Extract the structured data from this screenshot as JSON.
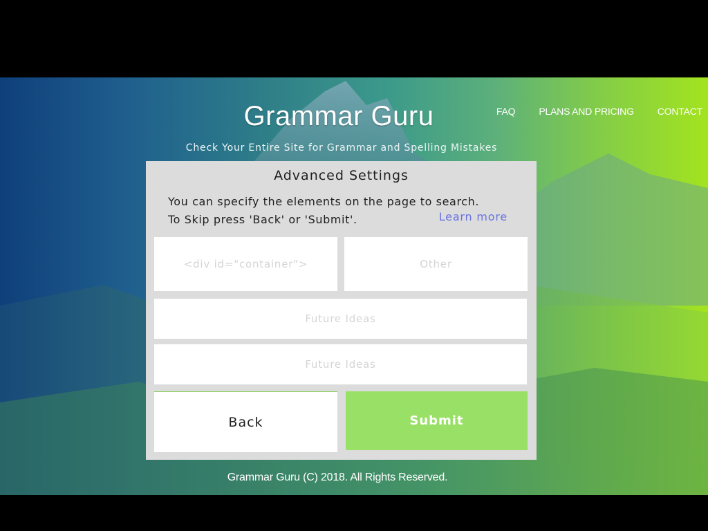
{
  "colors": {
    "panel_bg": "#dcdcdc",
    "submit_bg": "#99e066",
    "link": "#6b74e0",
    "page_top_bar": "#000000"
  },
  "header": {
    "title": "Grammar Guru",
    "tagline": "Check Your Entire Site for Grammar and Spelling Mistakes"
  },
  "nav": {
    "items": [
      {
        "label": "FAQ"
      },
      {
        "label": "PLANS AND PRICING"
      },
      {
        "label": "CONTACT"
      }
    ]
  },
  "panel": {
    "title": "Advanced Settings",
    "description_line1": "You can specify the elements on the page to search.",
    "description_line2": "To Skip press 'Back' or 'Submit'.",
    "learn_more": "Learn more",
    "fields": {
      "container": {
        "placeholder": "<div id=\"container\">",
        "value": ""
      },
      "other": {
        "placeholder": "Other",
        "value": ""
      },
      "future1": {
        "placeholder": "Future Ideas",
        "value": ""
      },
      "future2": {
        "placeholder": "Future Ideas",
        "value": ""
      }
    },
    "buttons": {
      "back": "Back",
      "submit": "Submit"
    }
  },
  "footer": {
    "text": "Grammar Guru (C) 2018. All Rights Reserved."
  }
}
